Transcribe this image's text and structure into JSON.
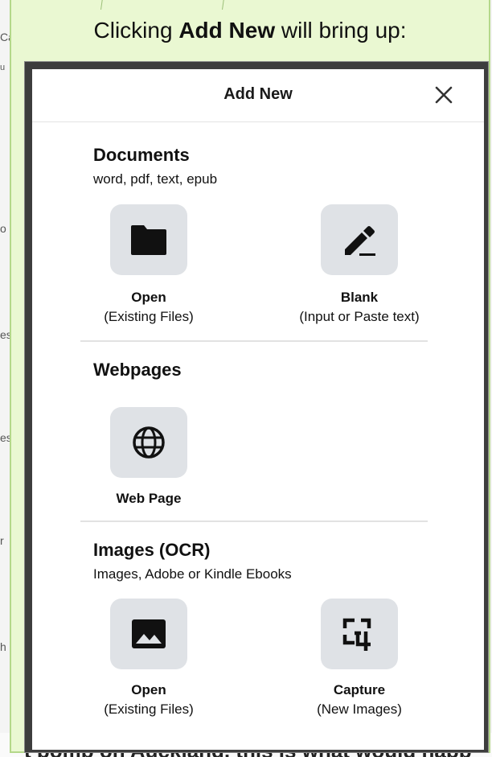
{
  "headline": {
    "prefix": "Clicking ",
    "bold": "Add New",
    "suffix": " will bring up:"
  },
  "background": {
    "left_fragments": [
      "Ca",
      "u",
      "o",
      "es",
      "es",
      "r",
      "h"
    ],
    "bottom_text": "t bomb on Auckland, this is what would happ"
  },
  "dialog": {
    "title": "Add New",
    "close_icon": "close-icon",
    "sections": [
      {
        "title": "Documents",
        "subtitle": "word, pdf, text, epub",
        "items": [
          {
            "icon": "folder-icon",
            "label": "Open",
            "sublabel": "(Existing Files)"
          },
          {
            "icon": "pencil-icon",
            "label": "Blank",
            "sublabel": "(Input or Paste text)"
          }
        ]
      },
      {
        "title": "Webpages",
        "items": [
          {
            "icon": "globe-icon",
            "label": "Web Page"
          }
        ]
      },
      {
        "title": "Images (OCR)",
        "subtitle": "Images, Adobe or Kindle Ebooks",
        "items": [
          {
            "icon": "image-icon",
            "label": "Open",
            "sublabel": "(Existing Files)"
          },
          {
            "icon": "crop-capture-icon",
            "label": "Capture",
            "sublabel": "(New Images)"
          }
        ]
      }
    ]
  },
  "colors": {
    "callout_bg": "#eaf8d2",
    "callout_border": "#b4d88a",
    "tile_bg": "#dfe2e6"
  }
}
